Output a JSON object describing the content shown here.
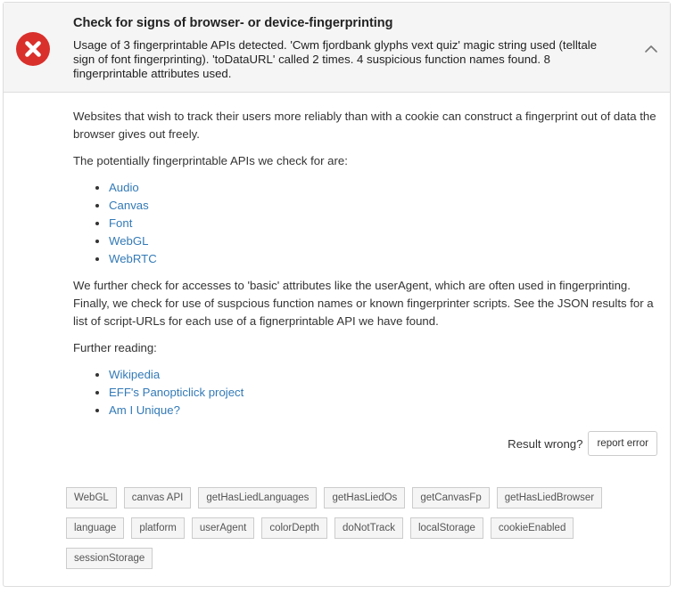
{
  "header": {
    "title": "Check for signs of browser- or device-fingerprinting",
    "summary": "Usage of 3 fingerprintable APIs detected. 'Cwm fjordbank glyphs vext quiz' magic string used (telltale sign of font fingerprinting). 'toDataURL' called 2 times. 4 suspicious function names found. 8 fingerprintable attributes used.",
    "status_icon": "error-x-icon",
    "toggle_icon": "chevron-up-icon",
    "status_color": "#d9302c"
  },
  "body": {
    "intro": "Websites that wish to track their users more reliably than with a cookie can construct a fingerprint out of data the browser gives out freely.",
    "apis_intro": "The potentially fingerprintable APIs we check for are:",
    "apis": [
      "Audio",
      "Canvas",
      "Font",
      "WebGL",
      "WebRTC"
    ],
    "further_check": "We further check for accesses to 'basic' attributes like the userAgent, which are often used in fingerprinting. Finally, we check for use of suspcious function names or known fingerprinter scripts. See the JSON results for a list of script-URLs for each use of a fignerprintable API we have found.",
    "further_reading_label": "Further reading:",
    "reading_links": [
      "Wikipedia",
      "EFF's Panopticlick project",
      "Am I Unique?"
    ],
    "link_color": "#337ab7"
  },
  "report": {
    "label": "Result wrong?",
    "button": "report error"
  },
  "tags": [
    "WebGL",
    "canvas API",
    "getHasLiedLanguages",
    "getHasLiedOs",
    "getCanvasFp",
    "getHasLiedBrowser",
    "language",
    "platform",
    "userAgent",
    "colorDepth",
    "doNotTrack",
    "localStorage",
    "cookieEnabled",
    "sessionStorage"
  ]
}
